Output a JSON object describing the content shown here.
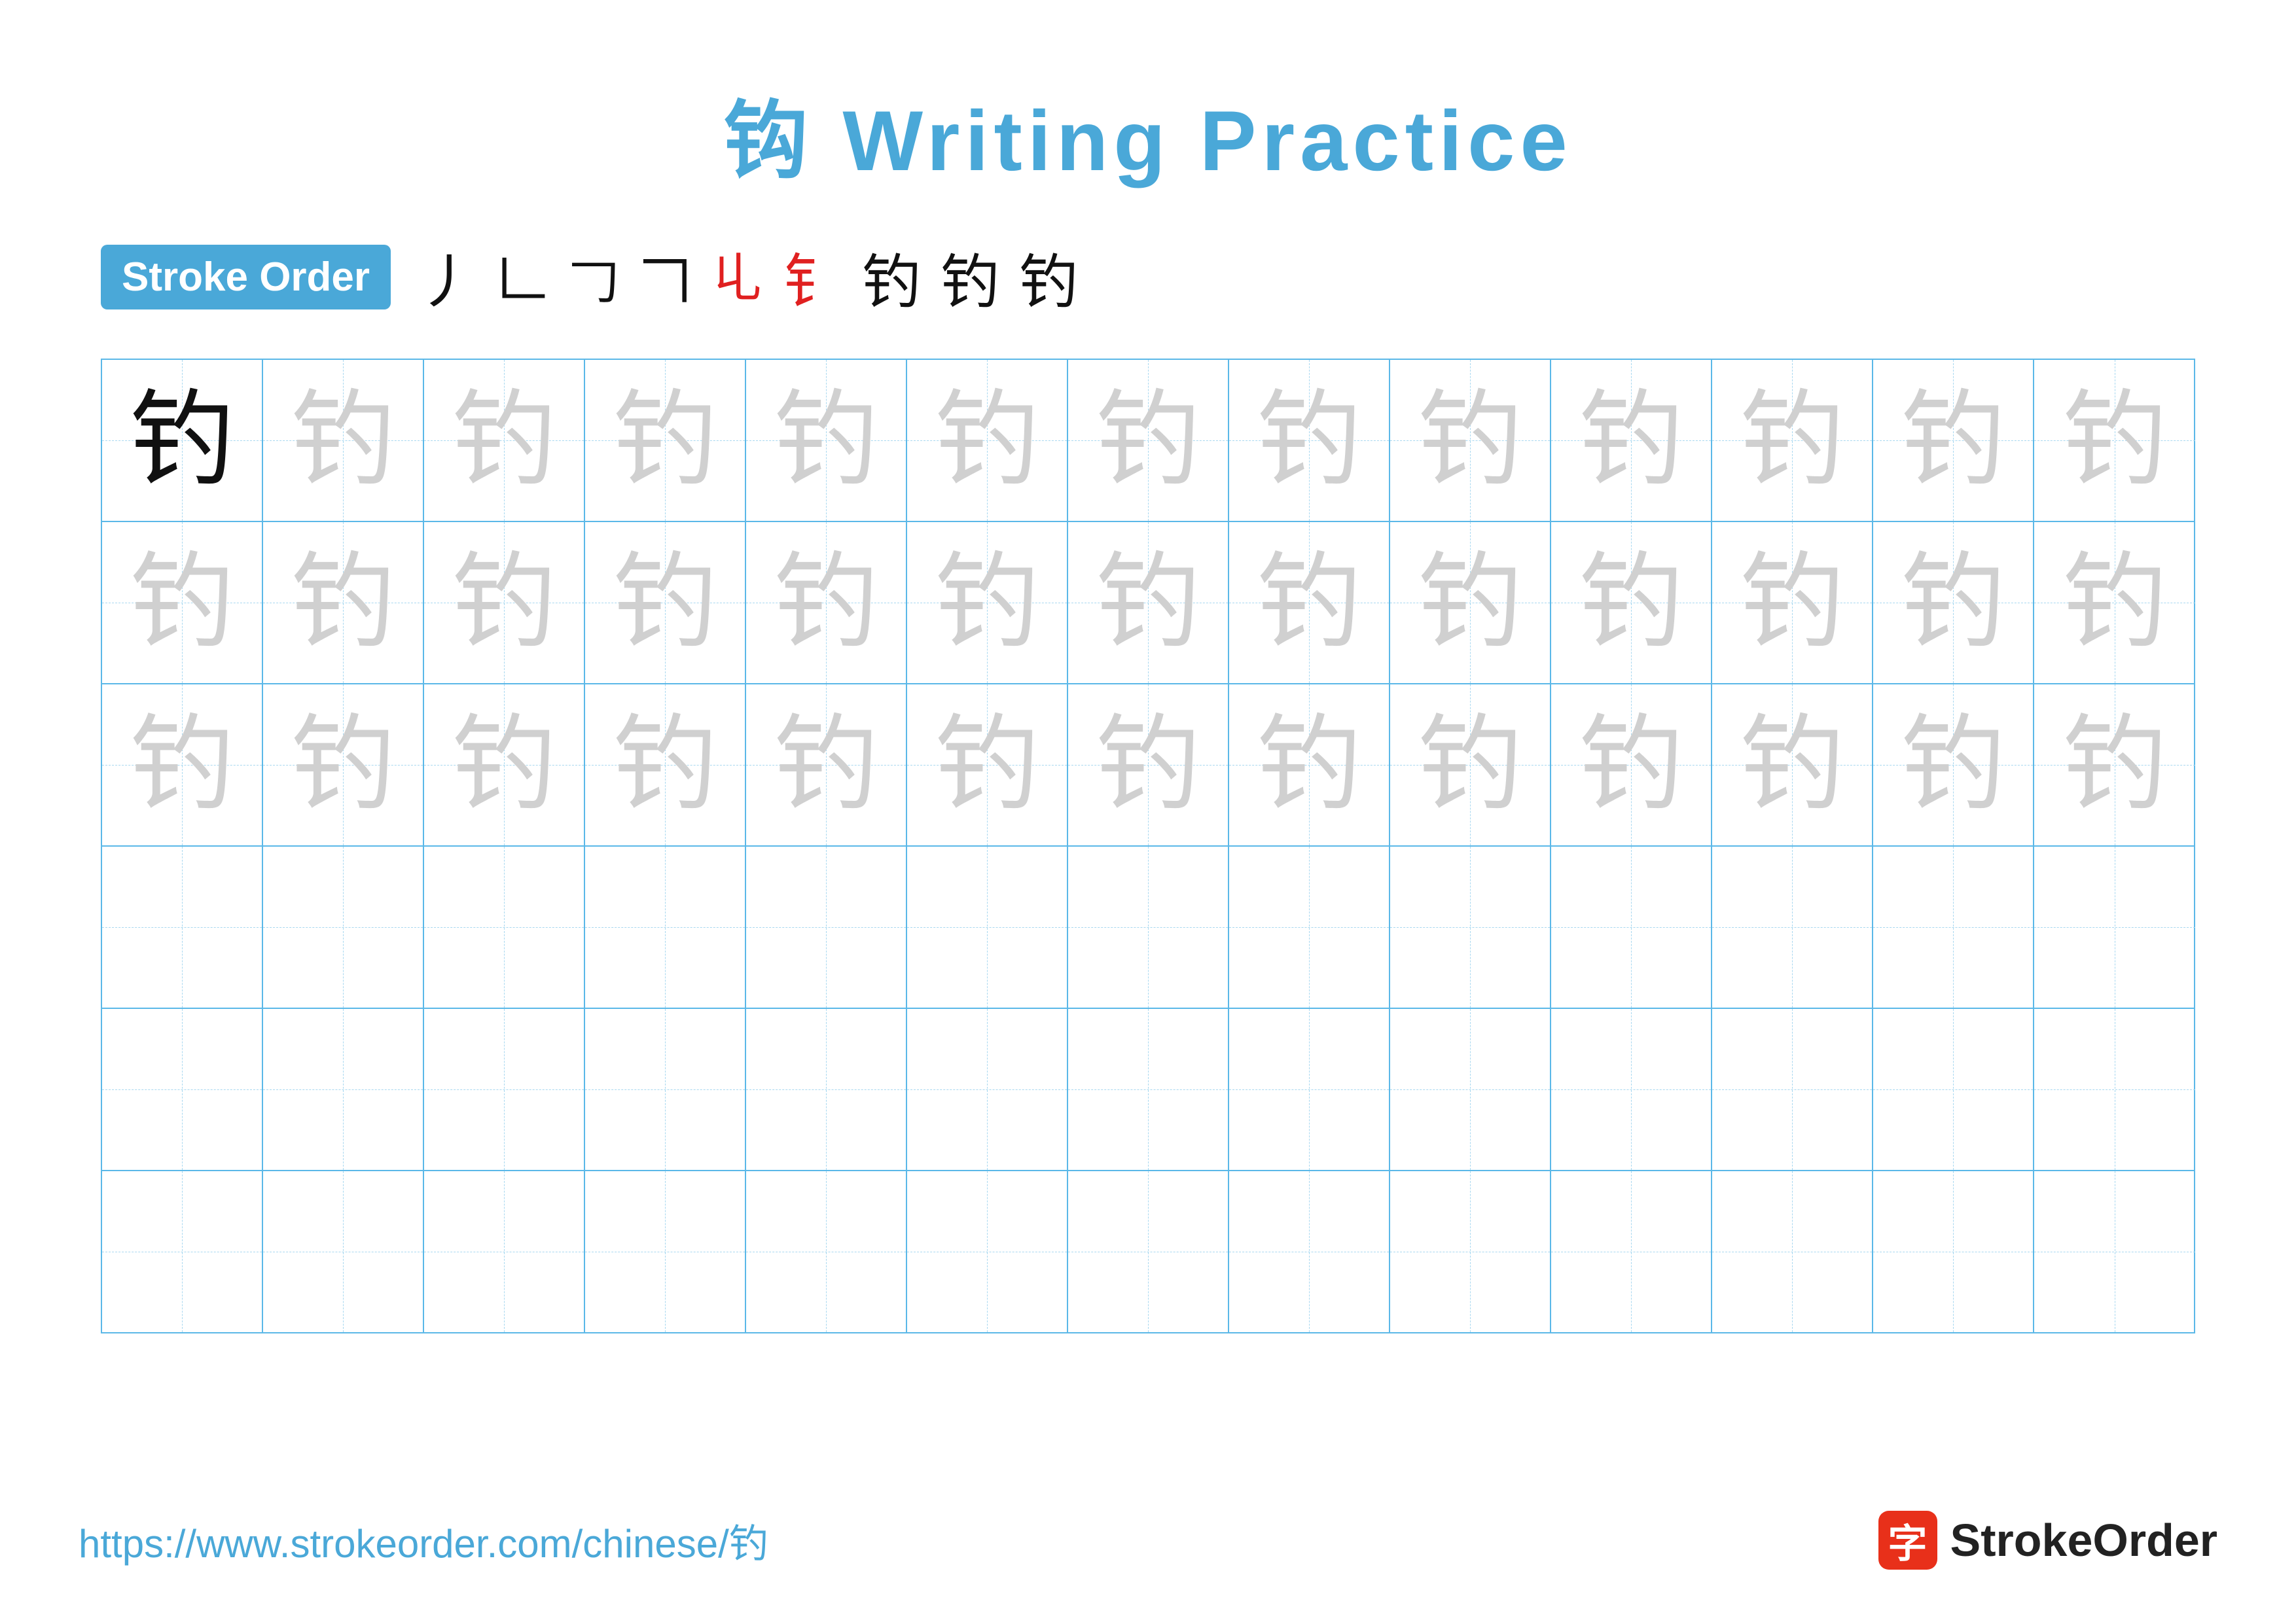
{
  "title": "钩 Writing Practice",
  "strokeOrder": {
    "badge": "Stroke Order",
    "steps": [
      "丿",
      "𠃊",
      "𠃍",
      "𠃌",
      "𠃏",
      "钅",
      "钓",
      "钓",
      "钓"
    ]
  },
  "grid": {
    "rows": 6,
    "cols": 13,
    "character": "钓",
    "row1": [
      "solid",
      "light",
      "light",
      "light",
      "light",
      "light",
      "light",
      "light",
      "light",
      "light",
      "light",
      "light",
      "light"
    ],
    "row2": [
      "light",
      "light",
      "light",
      "light",
      "light",
      "light",
      "light",
      "light",
      "light",
      "light",
      "light",
      "light",
      "light"
    ],
    "row3": [
      "light",
      "light",
      "light",
      "light",
      "light",
      "light",
      "light",
      "light",
      "light",
      "light",
      "light",
      "light",
      "light"
    ],
    "row4": [
      "empty",
      "empty",
      "empty",
      "empty",
      "empty",
      "empty",
      "empty",
      "empty",
      "empty",
      "empty",
      "empty",
      "empty",
      "empty"
    ],
    "row5": [
      "empty",
      "empty",
      "empty",
      "empty",
      "empty",
      "empty",
      "empty",
      "empty",
      "empty",
      "empty",
      "empty",
      "empty",
      "empty"
    ],
    "row6": [
      "empty",
      "empty",
      "empty",
      "empty",
      "empty",
      "empty",
      "empty",
      "empty",
      "empty",
      "empty",
      "empty",
      "empty",
      "empty"
    ]
  },
  "footer": {
    "url": "https://www.strokeorder.com/chinese/钓",
    "logoText": "StrokeOrder",
    "logoChar": "字"
  }
}
